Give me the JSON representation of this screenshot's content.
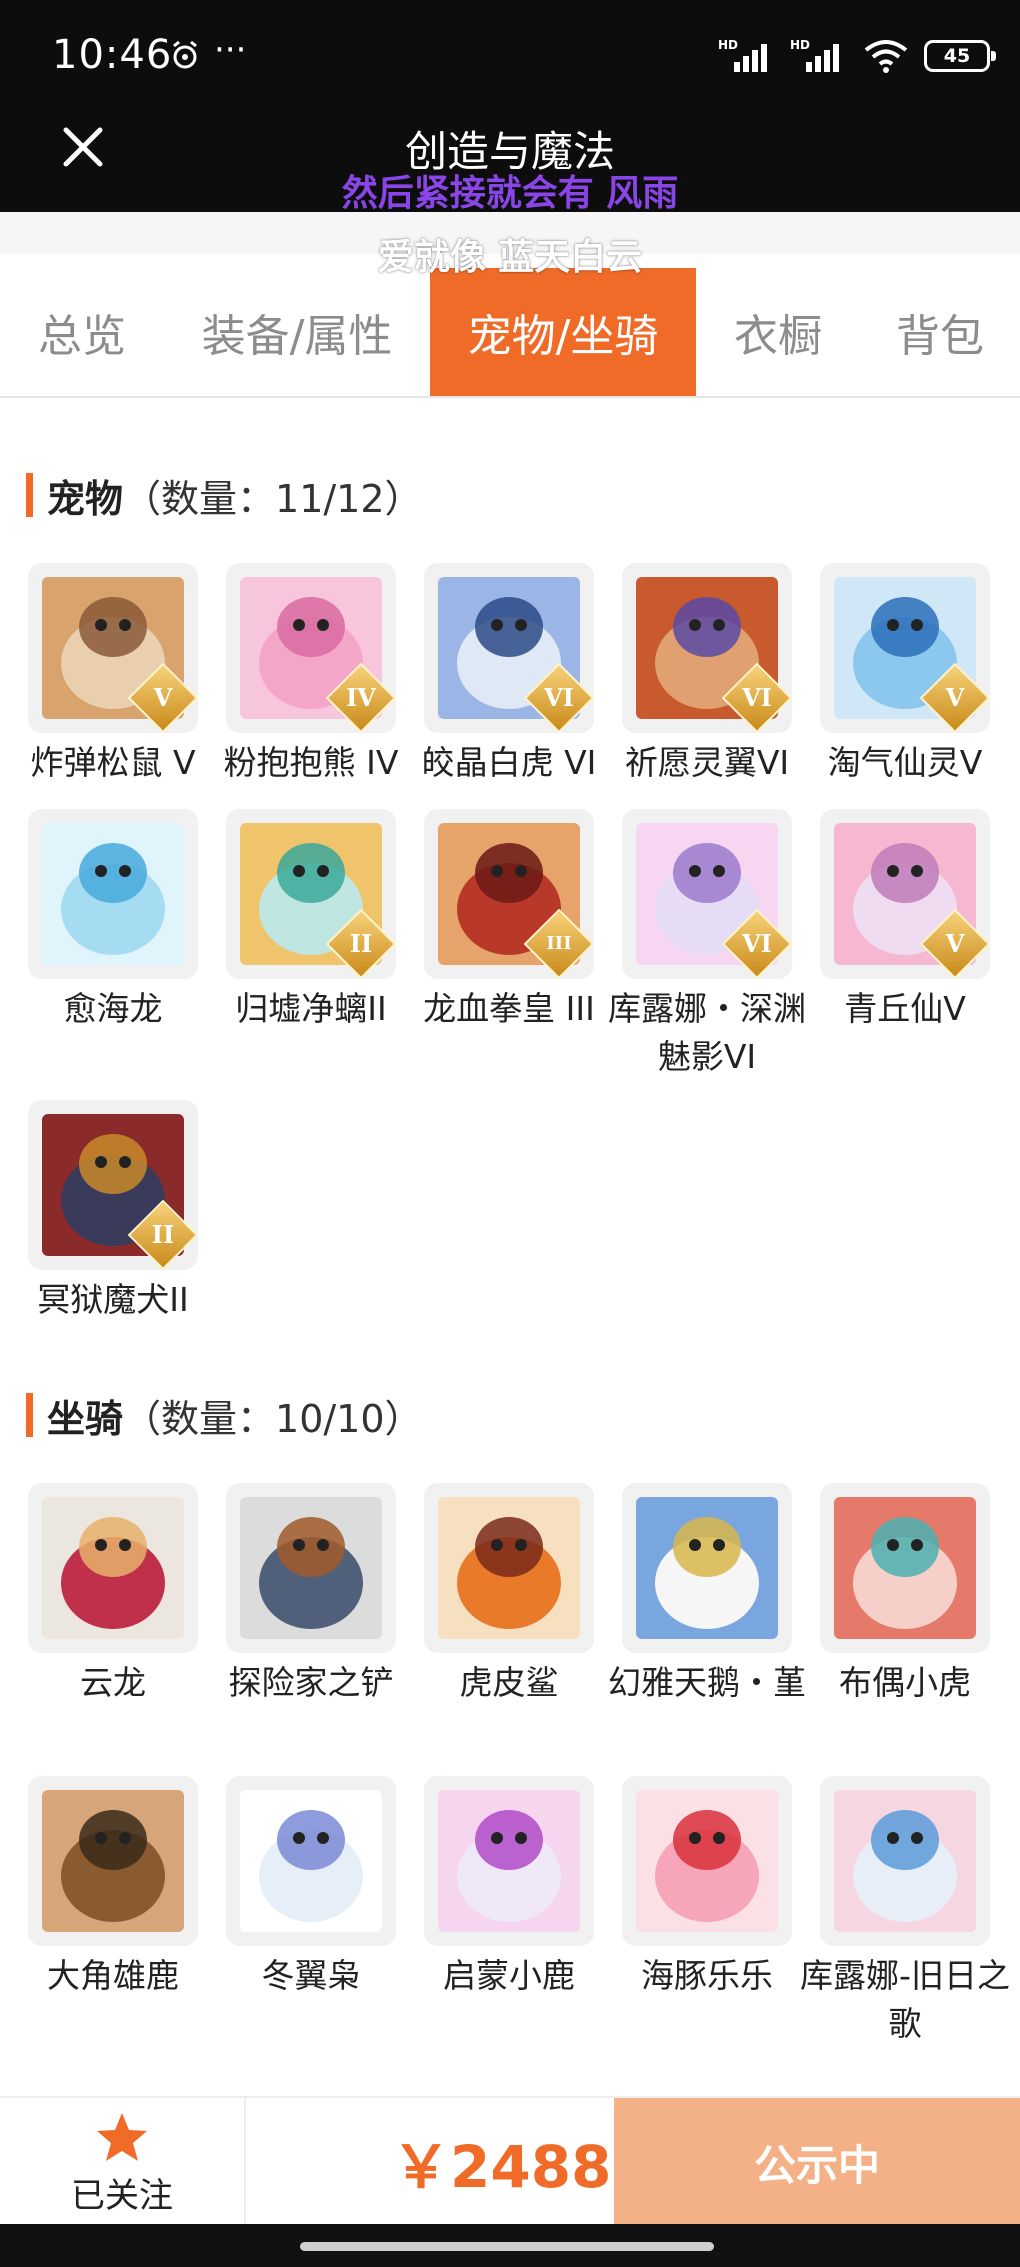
{
  "status_bar": {
    "time": "10:46",
    "dots": "···",
    "signal_label": "HD",
    "battery": "45"
  },
  "header": {
    "title": "创造与魔法",
    "lyric_line1": "然后紧接就会有 风雨",
    "lyric_line2": "爱就像 蓝天白云"
  },
  "tabs": [
    {
      "label": "总览"
    },
    {
      "label": "装备/属性"
    },
    {
      "label": "宠物/坐骑",
      "active": true
    },
    {
      "label": "衣橱"
    },
    {
      "label": "背包"
    }
  ],
  "pets": {
    "title": "宠物",
    "count": "（数量：11/12）",
    "items": [
      {
        "name": "炸弹松鼠 V",
        "badge": "V"
      },
      {
        "name": "粉抱抱熊 IV",
        "badge": "IV"
      },
      {
        "name": "皎晶白虎 VI",
        "badge": "VI"
      },
      {
        "name": "祈愿灵翼VI",
        "badge": "VI"
      },
      {
        "name": "淘气仙灵V",
        "badge": "V"
      },
      {
        "name": "愈海龙",
        "badge": ""
      },
      {
        "name": "归墟净螭II",
        "badge": "II"
      },
      {
        "name": "龙血拳皇 III",
        "badge": "III"
      },
      {
        "name": "库露娜・深渊魅影VI",
        "badge": "VI"
      },
      {
        "name": "青丘仙V",
        "badge": "V"
      },
      {
        "name": "冥狱魔犬II",
        "badge": "II"
      }
    ]
  },
  "mounts": {
    "title": "坐骑",
    "count": "（数量：10/10）",
    "items": [
      {
        "name": "云龙"
      },
      {
        "name": "探险家之铲"
      },
      {
        "name": "虎皮鲨"
      },
      {
        "name": "幻雅天鹅・堇"
      },
      {
        "name": "布偶小虎"
      },
      {
        "name": "大角雄鹿"
      },
      {
        "name": "冬翼枭"
      },
      {
        "name": "启蒙小鹿"
      },
      {
        "name": "海豚乐乐"
      },
      {
        "name": "库露娜-旧日之歌"
      }
    ]
  },
  "bottom": {
    "follow_label": "已关注",
    "price": "￥2488",
    "status_button": "公示中"
  },
  "colors": {
    "accent": "#f06a28",
    "lyric": "#8a45e8",
    "button_soft": "#f4b086"
  }
}
